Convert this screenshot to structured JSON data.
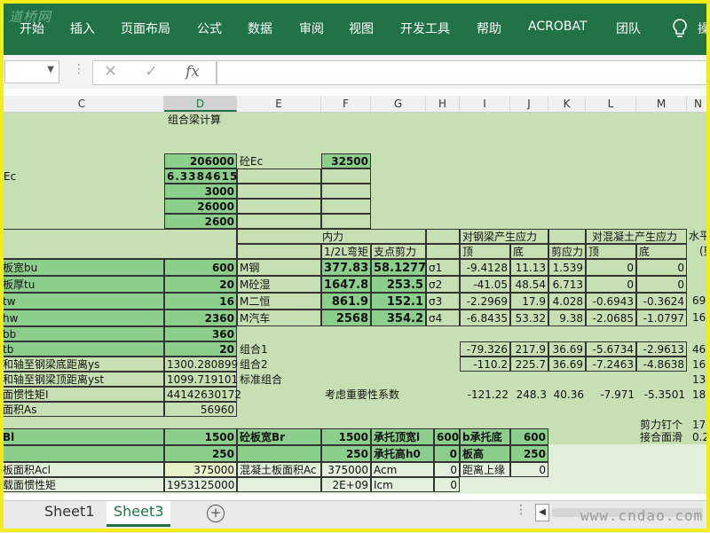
{
  "ribbon": {
    "logo": "道桥网",
    "tabs": [
      "开始",
      "插入",
      "页面布局",
      "公式",
      "数据",
      "审阅",
      "视图",
      "开发工具",
      "帮助",
      "ACROBAT",
      "团队"
    ],
    "tell_me": "操"
  },
  "formula_bar": {
    "cancel": "✕",
    "enter": "✓",
    "fx": "fx",
    "value": ""
  },
  "columns": [
    "C",
    "D",
    "E",
    "F",
    "G",
    "H",
    "I",
    "J",
    "K",
    "L",
    "M",
    "N"
  ],
  "selected_column": "D",
  "cells": {
    "title": "组合梁计算",
    "r4": {
      "d": "206000",
      "e": "砼Ec",
      "f": "32500"
    },
    "r5": {
      "c": "Ec",
      "d": "6.3384615"
    },
    "r6": {
      "d": "3000"
    },
    "r7": {
      "d": "26000"
    },
    "r8": {
      "d": "2600"
    },
    "hdr_internal_force": "内力",
    "hdr_steel_stress": "对钢梁产生应力",
    "hdr_concrete_stress": "对混凝土产生应力",
    "hdr_horizontal": "水平",
    "hdr_moment": "1/2L弯矩",
    "hdr_shear": "支点剪力",
    "hdr_top": "顶",
    "hdr_bottom": "底",
    "hdr_shear_stress": "剪应力",
    "hdr_top2": "顶",
    "hdr_bottom2": "底",
    "hdr_paren": "(剪",
    "r11": {
      "c": "板宽bu",
      "d": "600",
      "e": "M钢",
      "f": "377.83",
      "g": "58.1277",
      "h": "σ1",
      "i": "-9.4128",
      "j": "11.13",
      "k": "1.539",
      "l": "0",
      "m": "0"
    },
    "r12": {
      "c": "板厚tu",
      "d": "20",
      "e": "M砼湿",
      "f": "1647.8",
      "g": "253.5",
      "h": "σ2",
      "i": "-41.05",
      "j": "48.54",
      "k": "6.713",
      "l": "0",
      "m": "0"
    },
    "r13": {
      "c": "tw",
      "d": "16",
      "e": "M二恒",
      "f": "861.9",
      "g": "152.1",
      "h": "σ3",
      "i": "-2.2969",
      "j": "17.9",
      "k": "4.028",
      "l": "-0.6943",
      "m": "-0.3624",
      "n": "69"
    },
    "r14": {
      "c": "hw",
      "d": "2360",
      "e": "M汽车",
      "f": "2568",
      "g": "354.2",
      "h": "σ4",
      "i": "-6.8435",
      "j": "53.32",
      "k": "9.38",
      "l": "-2.0685",
      "m": "-1.0797",
      "n": "16"
    },
    "r15": {
      "c": "bb",
      "d": "360"
    },
    "r16": {
      "c": "tb",
      "d": "20",
      "e": "组合1",
      "i": "-79.326",
      "j": "217.9",
      "k": "36.69",
      "l": "-5.6734",
      "m": "-2.9613",
      "n": "46"
    },
    "r17": {
      "c": "和轴至钢梁底距离ys",
      "d": "1300.280899",
      "e": "组合2",
      "i": "-110.2",
      "j": "225.7",
      "k": "36.69",
      "l": "-7.2463",
      "m": "-4.8638",
      "n": "16"
    },
    "r18": {
      "c": "和轴至钢梁顶距离yst",
      "d": "1099.719101",
      "e": "标准组合",
      "n": "13"
    },
    "r19": {
      "c": "面惯性矩I",
      "d": "44142630172",
      "f": "考虑重要性系数",
      "i": "-121.22",
      "j": "248.3",
      "k": "40.36",
      "l": "-7.971",
      "m": "-5.3501",
      "n": "18"
    },
    "r20": {
      "c": "面积As",
      "d": "56960"
    },
    "r21": {
      "l": "剪力钉个",
      "n": "17"
    },
    "r22": {
      "c": "Bl",
      "d": "1500",
      "e": "砼板宽Br",
      "f": "1500",
      "g": "承托顶宽l",
      "h": "600",
      "i": "b承托底",
      "j": "600",
      "l": "接合面滑",
      "n": "0.2"
    },
    "r23": {
      "d": "250",
      "f": "250",
      "g": "承托高h0",
      "h": "0",
      "i": "板高",
      "j": "250"
    },
    "r24": {
      "c": "板面积Acl",
      "d": "375000",
      "e": "混凝土板面积Ac",
      "f": "375000",
      "g": "Acm",
      "h": "0",
      "i": "距离上缘",
      "j": "0"
    },
    "r25": {
      "c": "载面惯性矩",
      "d": "1953125000",
      "f": "2E+09",
      "g": "Icm",
      "h": "0"
    }
  },
  "sheets": [
    "Sheet1",
    "Sheet3"
  ],
  "active_sheet": "Sheet3",
  "watermark": "www.cndao.com",
  "colors": {
    "ribbon": "#217346",
    "cell_green": "#c6e0b4",
    "cell_green_dark": "#8ccf8c",
    "frame": "#f2ec1a"
  }
}
